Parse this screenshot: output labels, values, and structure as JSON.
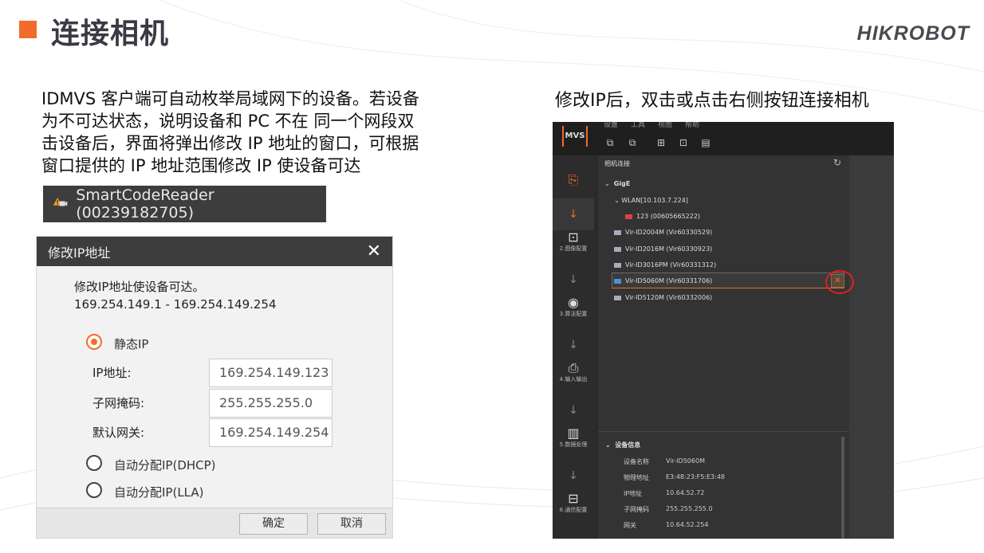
{
  "header": {
    "title": "连接相机",
    "brand": "HIKROBOT"
  },
  "left_description": {
    "lines": [
      "IDMVS 客户端可自动枚举局域网下的设备。若设备",
      "为不可达状态，说明设备和  PC 不在 同一个网段双",
      "击设备后，界面将弹出修改  IP 地址的窗口，可根据",
      "窗口提供的  IP 地址范围修改 IP 使设备可达"
    ]
  },
  "right_description": "修改IP后，双击或点击右侧按钮连接相机",
  "device_bar": {
    "label": "SmartCodeReader (00239182705)"
  },
  "dialog": {
    "title": "修改IP地址",
    "close": "✕",
    "hint": "修改IP地址使设备可达。",
    "range": "169.254.149.1 - 169.254.149.254",
    "options": {
      "static": "静态IP",
      "dhcp": "自动分配IP(DHCP)",
      "lla": "自动分配IP(LLA)"
    },
    "selected": "static",
    "fields": [
      {
        "label": "IP地址:",
        "value": "169.254.149.123"
      },
      {
        "label": "子网掩码:",
        "value": "255.255.255.0"
      },
      {
        "label": "默认网关:",
        "value": "169.254.149.254"
      }
    ],
    "buttons": {
      "ok": "确定",
      "cancel": "取消"
    }
  },
  "app": {
    "logo": "MVS",
    "menu": [
      "设置",
      "工具",
      "视图",
      "帮助"
    ],
    "sidebar": [
      {
        "label": "",
        "icon": "camera-link-icon"
      },
      {
        "label": "2.图像配置",
        "icon": "image-settings-icon"
      },
      {
        "label": "3.算法配置",
        "icon": "algorithm-icon"
      },
      {
        "label": "4.输入输出",
        "icon": "io-icon"
      },
      {
        "label": "5.数据处理",
        "icon": "barcode-icon"
      },
      {
        "label": "6.通信配置",
        "icon": "network-icon"
      }
    ],
    "panel_title": "相机连接",
    "tree": {
      "group": "GigE",
      "nic": "WLAN[10.103.7.224]",
      "devices": [
        {
          "name": "123 (00605665222)",
          "state": "unreachable"
        },
        {
          "name": "Vir-ID2004M (Vir60330529)",
          "state": "normal"
        },
        {
          "name": "Vir-ID2016M (Vir60330923)",
          "state": "normal"
        },
        {
          "name": "Vir-ID3016PM (Vir60331312)",
          "state": "normal"
        },
        {
          "name": "Vir-ID5060M (Vir60331706)",
          "state": "selected"
        },
        {
          "name": "Vir-ID5120M (Vir60332006)",
          "state": "normal"
        }
      ]
    },
    "device_info": {
      "title": "设备信息",
      "rows": [
        {
          "key": "设备名称",
          "value": "Vir-ID5060M"
        },
        {
          "key": "物理地址",
          "value": "E3:48:23:F5:E3:48"
        },
        {
          "key": "IP地址",
          "value": "10.64.52.72"
        },
        {
          "key": "子网掩码",
          "value": "255.255.255.0"
        },
        {
          "key": "网关",
          "value": "10.64.52.254"
        }
      ]
    }
  },
  "colors": {
    "accent": "#f26b2a",
    "dialog_header": "#3d3d3d",
    "app_bg": "#2a2a2a",
    "highlight": "#e02020"
  }
}
